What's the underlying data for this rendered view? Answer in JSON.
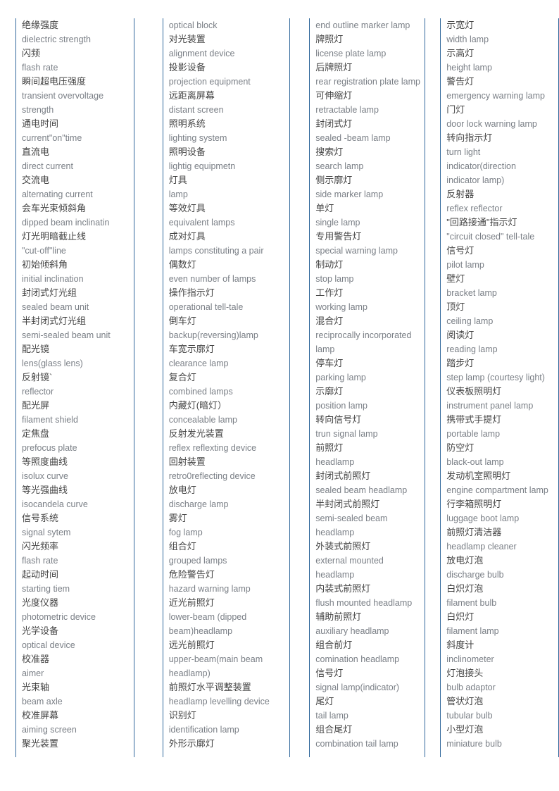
{
  "document": {
    "type": "bilingual-glossary",
    "subject": "automotive lighting terminology",
    "columns_count": 4,
    "colors": {
      "column_rule": "#31689c",
      "chinese_text": "#444444",
      "english_text": "#7a7f86",
      "page_background": "#ffffff"
    }
  },
  "columns": [
    {
      "id": "column-1",
      "lines": [
        {
          "lang": "zh",
          "text": "绝缘强度"
        },
        {
          "lang": "en",
          "text": "dielectric strength"
        },
        {
          "lang": "zh",
          "text": "闪频"
        },
        {
          "lang": "en",
          "text": "flash rate"
        },
        {
          "lang": "zh",
          "text": "瞬间超电压强度"
        },
        {
          "lang": "en",
          "text": "transient overvoltage"
        },
        {
          "lang": "en",
          "text": "strength"
        },
        {
          "lang": "zh",
          "text": "通电时间"
        },
        {
          "lang": "en",
          "text": "current\"on\"time"
        },
        {
          "lang": "zh",
          "text": "直流电"
        },
        {
          "lang": "en",
          "text": "direct current"
        },
        {
          "lang": "zh",
          "text": "交流电"
        },
        {
          "lang": "en",
          "text": "alternating current"
        },
        {
          "lang": "zh",
          "text": "会车光束倾斜角"
        },
        {
          "lang": "en",
          "text": "dipped beam inclinatin"
        },
        {
          "lang": "zh",
          "text": "灯光明暗截止线"
        },
        {
          "lang": "en",
          "text": "\"cut-off\"line"
        },
        {
          "lang": "zh",
          "text": "初始倾斜角"
        },
        {
          "lang": "en",
          "text": "initial inclination"
        },
        {
          "lang": "zh",
          "text": "封闭式灯光组"
        },
        {
          "lang": "en",
          "text": "sealed beam unit"
        },
        {
          "lang": "zh",
          "text": "半封闭式灯光组"
        },
        {
          "lang": "en",
          "text": "semi-sealed beam unit"
        },
        {
          "lang": "zh",
          "text": "配光镜"
        },
        {
          "lang": "en",
          "text": "lens(glass lens)"
        },
        {
          "lang": "zh",
          "text": "反射镜`"
        },
        {
          "lang": "en",
          "text": "reflector"
        },
        {
          "lang": "zh",
          "text": "配光屏"
        },
        {
          "lang": "en",
          "text": "filament shield"
        },
        {
          "lang": "zh",
          "text": "定焦盘"
        },
        {
          "lang": "en",
          "text": "prefocus plate"
        },
        {
          "lang": "zh",
          "text": "等照度曲线"
        },
        {
          "lang": "en",
          "text": "isolux curve"
        },
        {
          "lang": "zh",
          "text": "等光强曲线"
        },
        {
          "lang": "en",
          "text": "isocandela curve"
        },
        {
          "lang": "zh",
          "text": "信号系统"
        },
        {
          "lang": "en",
          "text": "signal sytem"
        },
        {
          "lang": "zh",
          "text": "闪光频率"
        },
        {
          "lang": "en",
          "text": "flash rate"
        },
        {
          "lang": "zh",
          "text": "起动时间"
        },
        {
          "lang": "en",
          "text": "starting tiem"
        },
        {
          "lang": "zh",
          "text": "光度仪器"
        },
        {
          "lang": "en",
          "text": "photometric device"
        },
        {
          "lang": "zh",
          "text": "光学设备"
        },
        {
          "lang": "en",
          "text": "optical device"
        },
        {
          "lang": "zh",
          "text": "校准器"
        },
        {
          "lang": "en",
          "text": "aimer"
        },
        {
          "lang": "zh",
          "text": "光束轴"
        },
        {
          "lang": "en",
          "text": "beam axle"
        },
        {
          "lang": "zh",
          "text": "校准屏幕"
        },
        {
          "lang": "en",
          "text": "aiming screen"
        },
        {
          "lang": "zh",
          "text": "聚光装置"
        }
      ]
    },
    {
      "id": "column-2",
      "lines": [
        {
          "lang": "en",
          "text": "optical block"
        },
        {
          "lang": "zh",
          "text": "对光装置"
        },
        {
          "lang": "en",
          "text": "alignment device"
        },
        {
          "lang": "zh",
          "text": "投影设备"
        },
        {
          "lang": "en",
          "text": "projection equipment"
        },
        {
          "lang": "zh",
          "text": "远距离屏幕"
        },
        {
          "lang": "en",
          "text": "distant screen"
        },
        {
          "lang": "zh",
          "text": "照明系统"
        },
        {
          "lang": "en",
          "text": "lighting system"
        },
        {
          "lang": "zh",
          "text": "照明设备"
        },
        {
          "lang": "en",
          "text": "lightig equipmetn"
        },
        {
          "lang": "zh",
          "text": "灯具"
        },
        {
          "lang": "en",
          "text": "lamp"
        },
        {
          "lang": "zh",
          "text": "等效灯具"
        },
        {
          "lang": "en",
          "text": "equivalent lamps"
        },
        {
          "lang": "zh",
          "text": "成对灯具"
        },
        {
          "lang": "en",
          "text": "lamps constituting a pair"
        },
        {
          "lang": "zh",
          "text": "偶数灯"
        },
        {
          "lang": "en",
          "text": "even number of lamps"
        },
        {
          "lang": "zh",
          "text": "操作指示灯"
        },
        {
          "lang": "en",
          "text": "operational tell-tale"
        },
        {
          "lang": "zh",
          "text": "倒车灯"
        },
        {
          "lang": "en",
          "text": "backup(reversing)lamp"
        },
        {
          "lang": "zh",
          "text": "车宽示廓灯"
        },
        {
          "lang": "en",
          "text": "clearance lamp"
        },
        {
          "lang": "zh",
          "text": "复合灯"
        },
        {
          "lang": "en",
          "text": "combined lamps"
        },
        {
          "lang": "zh",
          "text": "内藏灯(暗灯）"
        },
        {
          "lang": "en",
          "text": "concealable lamp"
        },
        {
          "lang": "zh",
          "text": "反射发光装置"
        },
        {
          "lang": "en",
          "text": "reflex reflexting device"
        },
        {
          "lang": "zh",
          "text": "回射装置"
        },
        {
          "lang": "en",
          "text": "retro0reflecting device"
        },
        {
          "lang": "zh",
          "text": "放电灯"
        },
        {
          "lang": "en",
          "text": "discharge lamp"
        },
        {
          "lang": "zh",
          "text": "雾灯"
        },
        {
          "lang": "en",
          "text": "fog lamp"
        },
        {
          "lang": "zh",
          "text": "组合灯"
        },
        {
          "lang": "en",
          "text": "grouped lamps"
        },
        {
          "lang": "zh",
          "text": "危险警告灯"
        },
        {
          "lang": "en",
          "text": "hazard warning lamp"
        },
        {
          "lang": "zh",
          "text": "近光前照灯"
        },
        {
          "lang": "en",
          "text": "lower-beam (dipped"
        },
        {
          "lang": "en",
          "text": "beam)headlamp"
        },
        {
          "lang": "zh",
          "text": "远光前照灯"
        },
        {
          "lang": "en",
          "text": "upper-beam(main beam"
        },
        {
          "lang": "en",
          "text": "headlamp)"
        },
        {
          "lang": "zh",
          "text": "前照灯水平调整装置"
        },
        {
          "lang": "en",
          "text": "headlamp levelling device"
        },
        {
          "lang": "zh",
          "text": "识别灯"
        },
        {
          "lang": "en",
          "text": "identification lamp"
        },
        {
          "lang": "zh",
          "text": "外形示廓灯"
        }
      ]
    },
    {
      "id": "column-3",
      "lines": [
        {
          "lang": "en",
          "text": "end outline marker lamp"
        },
        {
          "lang": "zh",
          "text": "牌照灯"
        },
        {
          "lang": "en",
          "text": "license plate lamp"
        },
        {
          "lang": "zh",
          "text": "后牌照灯"
        },
        {
          "lang": "en",
          "text": "rear registration plate lamp"
        },
        {
          "lang": "zh",
          "text": "可伸缩灯"
        },
        {
          "lang": "en",
          "text": "retractable lamp"
        },
        {
          "lang": "zh",
          "text": "封闭式灯"
        },
        {
          "lang": "en",
          "text": "sealed -beam lamp"
        },
        {
          "lang": "zh",
          "text": "搜索灯"
        },
        {
          "lang": "en",
          "text": "search lamp"
        },
        {
          "lang": "zh",
          "text": "侧示廓灯"
        },
        {
          "lang": "en",
          "text": "side marker lamp"
        },
        {
          "lang": "zh",
          "text": "单灯"
        },
        {
          "lang": "en",
          "text": "single lamp"
        },
        {
          "lang": "zh",
          "text": "专用警告灯"
        },
        {
          "lang": "en",
          "text": "special warning lamp"
        },
        {
          "lang": "zh",
          "text": "制动灯"
        },
        {
          "lang": "en",
          "text": "stop lamp"
        },
        {
          "lang": "zh",
          "text": "工作灯"
        },
        {
          "lang": "en",
          "text": "working lamp"
        },
        {
          "lang": "zh",
          "text": "混合灯"
        },
        {
          "lang": "en",
          "text": "reciprocally incorporated"
        },
        {
          "lang": "en",
          "text": "lamp"
        },
        {
          "lang": "zh",
          "text": "停车灯"
        },
        {
          "lang": "en",
          "text": "parking lamp"
        },
        {
          "lang": "zh",
          "text": "示廓灯"
        },
        {
          "lang": "en",
          "text": "position lamp"
        },
        {
          "lang": "zh",
          "text": "转向信号灯"
        },
        {
          "lang": "en",
          "text": "trun signal lamp"
        },
        {
          "lang": "zh",
          "text": "前照灯"
        },
        {
          "lang": "en",
          "text": "headlamp"
        },
        {
          "lang": "zh",
          "text": "封闭式前照灯"
        },
        {
          "lang": "en",
          "text": "sealed beam headlamp"
        },
        {
          "lang": "zh",
          "text": "半封闭式前照灯"
        },
        {
          "lang": "en",
          "text": "semi-sealed beam"
        },
        {
          "lang": "en",
          "text": "headlamp"
        },
        {
          "lang": "zh",
          "text": "外装式前照灯"
        },
        {
          "lang": "en",
          "text": "external mounted"
        },
        {
          "lang": "en",
          "text": "headlamp"
        },
        {
          "lang": "zh",
          "text": "内装式前照灯"
        },
        {
          "lang": "en",
          "text": "flush mounted headlamp"
        },
        {
          "lang": "zh",
          "text": "辅助前照灯"
        },
        {
          "lang": "en",
          "text": "auxiliary headlamp"
        },
        {
          "lang": "zh",
          "text": "组合前灯"
        },
        {
          "lang": "en",
          "text": "comination headlamp"
        },
        {
          "lang": "zh",
          "text": "信号灯"
        },
        {
          "lang": "en",
          "text": "signal lamp(indicator)"
        },
        {
          "lang": "zh",
          "text": "尾灯"
        },
        {
          "lang": "en",
          "text": "tail lamp"
        },
        {
          "lang": "zh",
          "text": "组合尾灯"
        },
        {
          "lang": "en",
          "text": "combination tail lamp"
        }
      ]
    },
    {
      "id": "column-4",
      "lines": [
        {
          "lang": "zh",
          "text": "示宽灯"
        },
        {
          "lang": "en",
          "text": "width lamp"
        },
        {
          "lang": "zh",
          "text": "示高灯"
        },
        {
          "lang": "en",
          "text": "height lamp"
        },
        {
          "lang": "zh",
          "text": "警告灯"
        },
        {
          "lang": "en",
          "text": "emergency warning lamp"
        },
        {
          "lang": "zh",
          "text": "门灯"
        },
        {
          "lang": "en",
          "text": "door lock warning lamp"
        },
        {
          "lang": "zh",
          "text": "转向指示灯"
        },
        {
          "lang": "en",
          "text": "turn light"
        },
        {
          "lang": "en",
          "text": "indicator(direction"
        },
        {
          "lang": "en",
          "text": "indicator lamp)"
        },
        {
          "lang": "zh",
          "text": "反射器"
        },
        {
          "lang": "en",
          "text": "reflex reflector"
        },
        {
          "lang": "zh",
          "text": "\"回路接通\"指示灯"
        },
        {
          "lang": "en",
          "text": "\"circuit closed\" tell-tale"
        },
        {
          "lang": "zh",
          "text": "信号灯"
        },
        {
          "lang": "en",
          "text": "pilot lamp"
        },
        {
          "lang": "zh",
          "text": "壁灯"
        },
        {
          "lang": "en",
          "text": "bracket lamp"
        },
        {
          "lang": "zh",
          "text": "顶灯"
        },
        {
          "lang": "en",
          "text": "ceiling lamp"
        },
        {
          "lang": "zh",
          "text": "阅读灯"
        },
        {
          "lang": "en",
          "text": "reading lamp"
        },
        {
          "lang": "zh",
          "text": "踏步灯"
        },
        {
          "lang": "en",
          "text": "step lamp (courtesy light)"
        },
        {
          "lang": "zh",
          "text": "仪表板照明灯"
        },
        {
          "lang": "en",
          "text": "instrument panel lamp"
        },
        {
          "lang": "zh",
          "text": "携带式手提灯"
        },
        {
          "lang": "en",
          "text": "portable lamp"
        },
        {
          "lang": "zh",
          "text": "防空灯"
        },
        {
          "lang": "en",
          "text": "black-out lamp"
        },
        {
          "lang": "zh",
          "text": "发动机室照明灯"
        },
        {
          "lang": "en",
          "text": "engine compartment lamp"
        },
        {
          "lang": "zh",
          "text": "行李箱照明灯"
        },
        {
          "lang": "en",
          "text": "luggage boot lamp"
        },
        {
          "lang": "zh",
          "text": "前照灯清洁器"
        },
        {
          "lang": "en",
          "text": "headlamp cleaner"
        },
        {
          "lang": "zh",
          "text": "放电灯泡"
        },
        {
          "lang": "en",
          "text": "discharge bulb"
        },
        {
          "lang": "zh",
          "text": "白炽灯泡"
        },
        {
          "lang": "en",
          "text": "filament bulb"
        },
        {
          "lang": "zh",
          "text": "白炽灯"
        },
        {
          "lang": "en",
          "text": "filament lamp"
        },
        {
          "lang": "zh",
          "text": "斜度计"
        },
        {
          "lang": "en",
          "text": "inclinometer"
        },
        {
          "lang": "zh",
          "text": "灯泡接头"
        },
        {
          "lang": "en",
          "text": "bulb adaptor"
        },
        {
          "lang": "zh",
          "text": "管状灯泡"
        },
        {
          "lang": "en",
          "text": "tubular bulb"
        },
        {
          "lang": "zh",
          "text": "小型灯泡"
        },
        {
          "lang": "en",
          "text": "miniature bulb"
        }
      ]
    }
  ]
}
